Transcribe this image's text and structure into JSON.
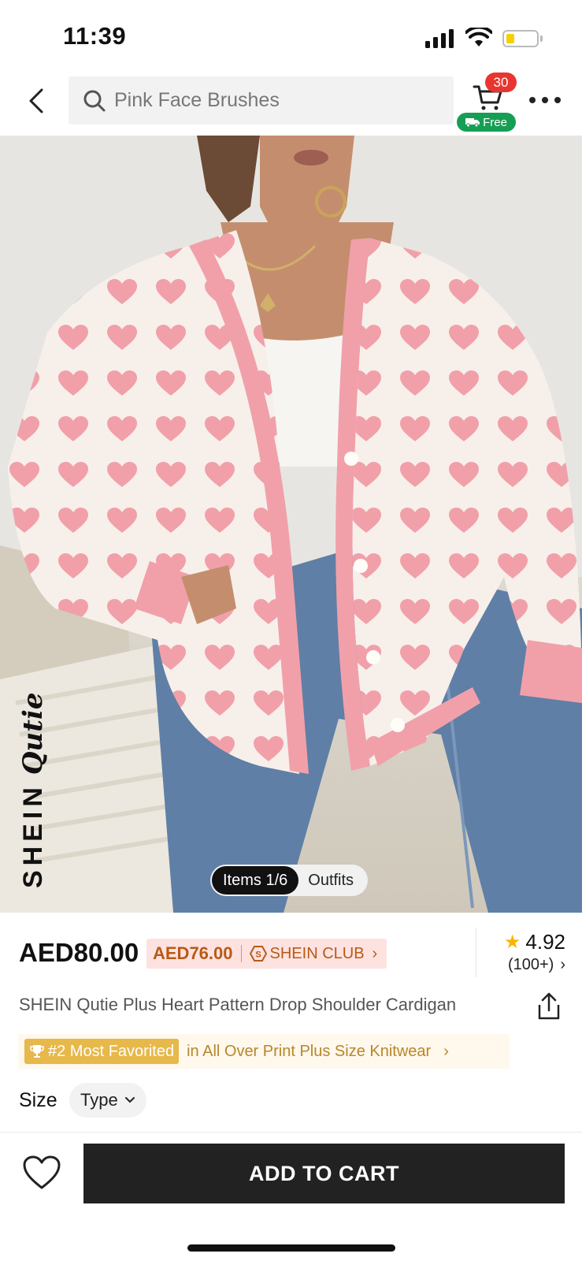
{
  "status_bar": {
    "time": "11:39"
  },
  "nav": {
    "search_placeholder": "Pink Face Brushes",
    "cart_count": "30",
    "cart_shipping": "Free"
  },
  "image": {
    "brand_word": "SHEIN",
    "brand_script": "Qutie",
    "pager_items": "Items 1/6",
    "pager_outfits": "Outfits"
  },
  "price": {
    "current": "AED80.00",
    "club_price": "AED76.00",
    "club_label": "SHEIN CLUB"
  },
  "rating": {
    "score": "4.92",
    "count": "(100+)"
  },
  "product": {
    "title": "SHEIN Qutie Plus Heart Pattern Drop Shoulder Cardigan"
  },
  "ranking": {
    "badge": "#2 Most Favorited",
    "text": "in All Over Print Plus Size Knitwear"
  },
  "size": {
    "label": "Size",
    "type": "Type"
  },
  "bottom": {
    "add_to_cart": "ADD TO CART"
  },
  "colors": {
    "cart_badge": "#e8352f",
    "free_badge": "#169e55",
    "club_bg": "#fde2e0",
    "club_text": "#b75a17",
    "rank_badge": "#e7b84a",
    "rank_text": "#b8862b",
    "star": "#f7b500",
    "cardigan_pink": "#f1a0aa",
    "cardigan_cream": "#f7f0ea",
    "denim": "#5f7fa6"
  }
}
